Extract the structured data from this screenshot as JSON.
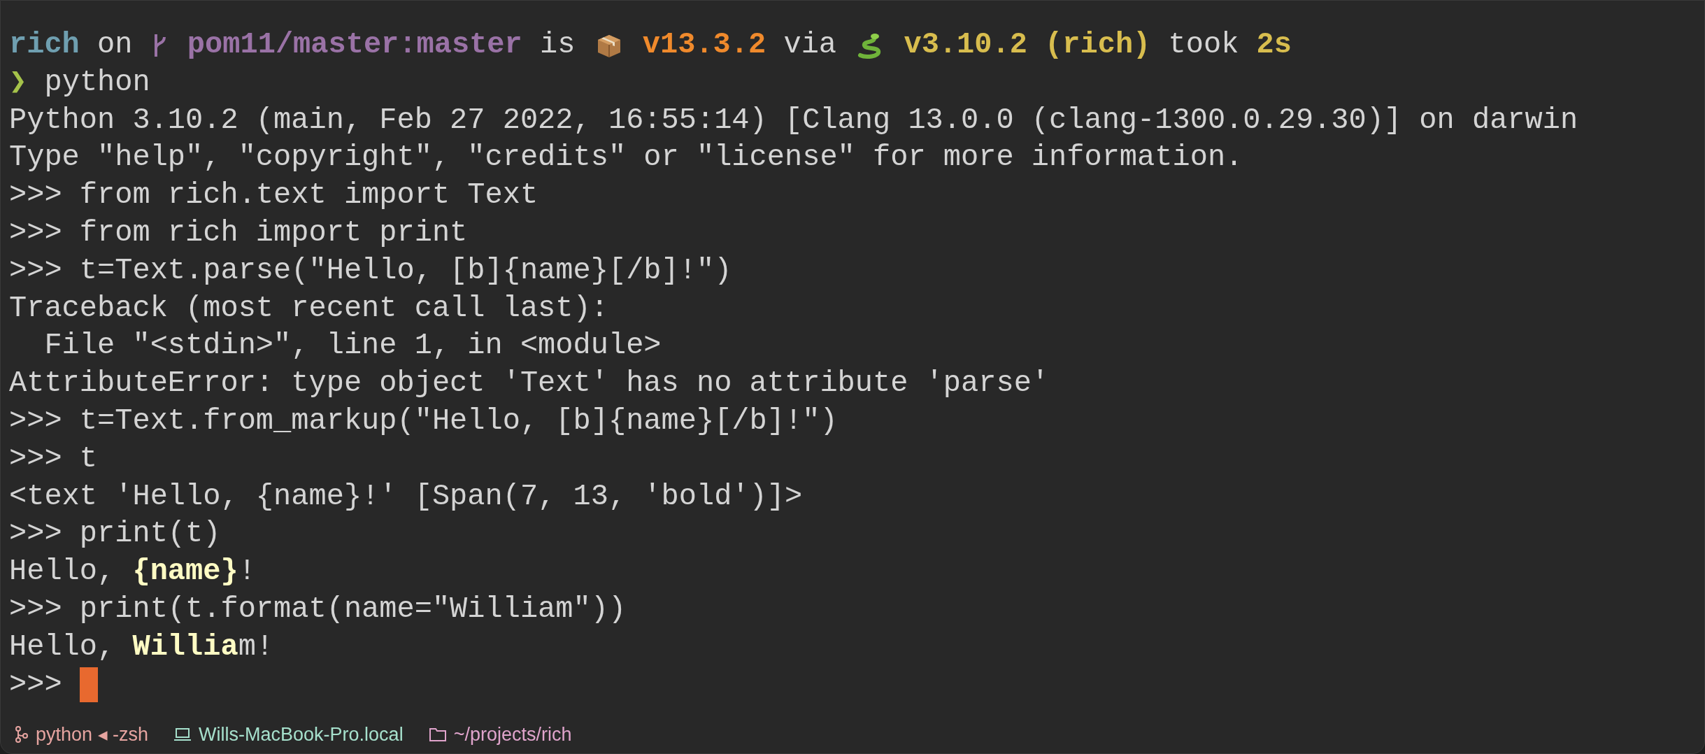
{
  "terminal": {
    "lines": [
      {
        "segments": [
          {
            "kind": "user",
            "text": "rich"
          },
          {
            "kind": "text",
            "text": " on "
          },
          {
            "kind": "vcs"
          },
          {
            "kind": "branch",
            "text": " pom11/master:master"
          },
          {
            "kind": "text",
            "text": " is "
          },
          {
            "kind": "package"
          },
          {
            "kind": "node",
            "text": " v13.3.2"
          },
          {
            "kind": "text",
            "text": " via "
          },
          {
            "kind": "runtime"
          },
          {
            "kind": "python",
            "text": " v3.10.2 (rich)"
          },
          {
            "kind": "text",
            "text": " took "
          },
          {
            "kind": "duration",
            "text": "2s"
          }
        ]
      },
      {
        "segments": [
          {
            "kind": "prompt",
            "text": "❯"
          },
          {
            "kind": "text",
            "text": " python"
          }
        ]
      },
      {
        "segments": [
          {
            "kind": "text",
            "text": "Python 3.10.2 (main, Feb 27 2022, 16:55:14) [Clang 13.0.0 (clang-1300.0.29.30)] on darwin"
          }
        ]
      },
      {
        "segments": [
          {
            "kind": "text",
            "text": "Type \"help\", \"copyright\", \"credits\" or \"license\" for more information."
          }
        ]
      },
      {
        "segments": [
          {
            "kind": "text",
            "text": ">>> from rich.text import Text"
          }
        ]
      },
      {
        "segments": [
          {
            "kind": "text",
            "text": ">>> from rich import print"
          }
        ]
      },
      {
        "segments": [
          {
            "kind": "text",
            "text": ">>> t=Text.parse(\"Hello, [b]{name}[/b]!\")"
          }
        ]
      },
      {
        "segments": [
          {
            "kind": "text",
            "text": "Traceback (most recent call last):"
          }
        ]
      },
      {
        "segments": [
          {
            "kind": "text",
            "text": "  File \"<stdin>\", line 1, in <module>"
          }
        ]
      },
      {
        "segments": [
          {
            "kind": "text",
            "text": "AttributeError: type object 'Text' has no attribute 'parse'"
          }
        ]
      },
      {
        "segments": [
          {
            "kind": "text",
            "text": ">>> t=Text.from_markup(\"Hello, [b]{name}[/b]!\")"
          }
        ]
      },
      {
        "segments": [
          {
            "kind": "text",
            "text": ">>> t"
          }
        ]
      },
      {
        "segments": [
          {
            "kind": "text",
            "text": "<text 'Hello, {name}!' [Span(7, 13, 'bold')]>"
          }
        ]
      },
      {
        "segments": [
          {
            "kind": "text",
            "text": ">>> print(t)"
          }
        ]
      },
      {
        "segments": [
          {
            "kind": "text",
            "text": "Hello, "
          },
          {
            "kind": "emphasis",
            "text": "{name}"
          },
          {
            "kind": "text",
            "text": "!"
          }
        ]
      },
      {
        "segments": [
          {
            "kind": "text",
            "text": ">>> print(t.format(name=\"William\"))"
          }
        ]
      },
      {
        "segments": [
          {
            "kind": "text",
            "text": "Hello, "
          },
          {
            "kind": "emphasis",
            "text": "Willia"
          },
          {
            "kind": "text",
            "text": "m!"
          }
        ]
      },
      {
        "segments": [
          {
            "kind": "text",
            "text": ">>> "
          },
          {
            "kind": "cursor"
          }
        ]
      }
    ]
  },
  "status_bar": [
    {
      "kind": "process",
      "text": "python ◂ -zsh"
    },
    {
      "kind": "host",
      "text": "Wills-MacBook-Pro.local"
    },
    {
      "kind": "folder",
      "text": "~/projects/rich"
    }
  ]
}
